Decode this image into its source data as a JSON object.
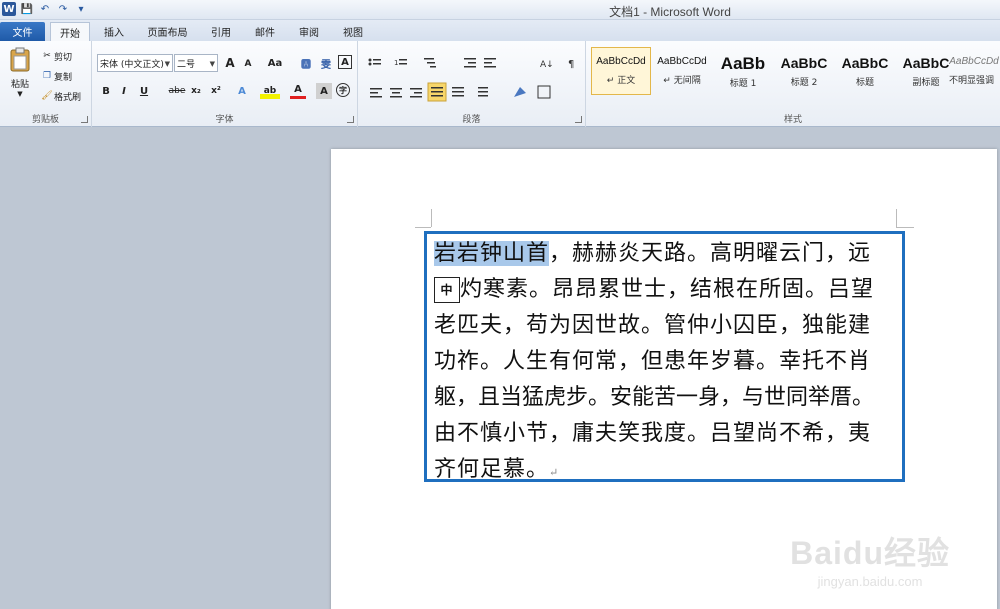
{
  "window": {
    "title": "文档1 - Microsoft Word"
  },
  "qat": {
    "logo": "W",
    "save": "💾",
    "undo": "↶",
    "redo": "↷",
    "customize": "▾"
  },
  "tabs": [
    {
      "label": "文件"
    },
    {
      "label": "开始"
    },
    {
      "label": "插入"
    },
    {
      "label": "页面布局"
    },
    {
      "label": "引用"
    },
    {
      "label": "邮件"
    },
    {
      "label": "审阅"
    },
    {
      "label": "视图"
    }
  ],
  "clipboard": {
    "paste": "粘贴",
    "cut": "剪切",
    "copy": "复制",
    "format_painter": "格式刷",
    "group_label": "剪贴板"
  },
  "font": {
    "name": "宋体 (中文正文)",
    "size": "二号",
    "group_label": "字体",
    "grow": "A",
    "shrink": "A",
    "case": "Aa",
    "clear": "🅰",
    "phonetic": "雯",
    "border_char": "A",
    "bold": "B",
    "italic": "I",
    "underline": "U",
    "strike": "abe",
    "sub": "x₂",
    "sup": "x²",
    "effects": "A",
    "highlight": "ab",
    "color": "A",
    "shade": "A",
    "enclose": "字"
  },
  "paragraph": {
    "group_label": "段落"
  },
  "styles": {
    "group_label": "样式",
    "items": [
      {
        "sample": "AaBbCcDd",
        "name": "↵ 正文",
        "selected": true
      },
      {
        "sample": "AaBbCcDd",
        "name": "↵ 无间隔",
        "selected": false
      },
      {
        "sample": "AaBb",
        "name": "标题 1",
        "selected": false
      },
      {
        "sample": "AaBbC",
        "name": "标题 2",
        "selected": false
      },
      {
        "sample": "AaBbC",
        "name": "标题",
        "selected": false
      },
      {
        "sample": "AaBbC",
        "name": "副标题",
        "selected": false
      },
      {
        "sample": "AaBbCcDd",
        "name": "不明显强调",
        "selected": false
      }
    ]
  },
  "document": {
    "selected_text": "岩岩钟山首",
    "ime_indicator": "中",
    "lines": [
      "，赫赫炎天路。高明曜云门，远",
      "灼寒素。昂昂累世士，结根在所固。吕望",
      "老匹夫，苟为因世故。管仲小囚臣，独能建",
      "功祚。人生有何常，但患年岁暮。幸托不肖",
      "躯，且当猛虎步。安能苦一身，与世同举厝。",
      "由不慎小节，庸夫笑我度。吕望尚不希，夷",
      "齐何足慕。"
    ],
    "para_mark": "↵"
  },
  "watermark": {
    "main": "Baidu经验",
    "sub": "jingyan.baidu.com"
  }
}
